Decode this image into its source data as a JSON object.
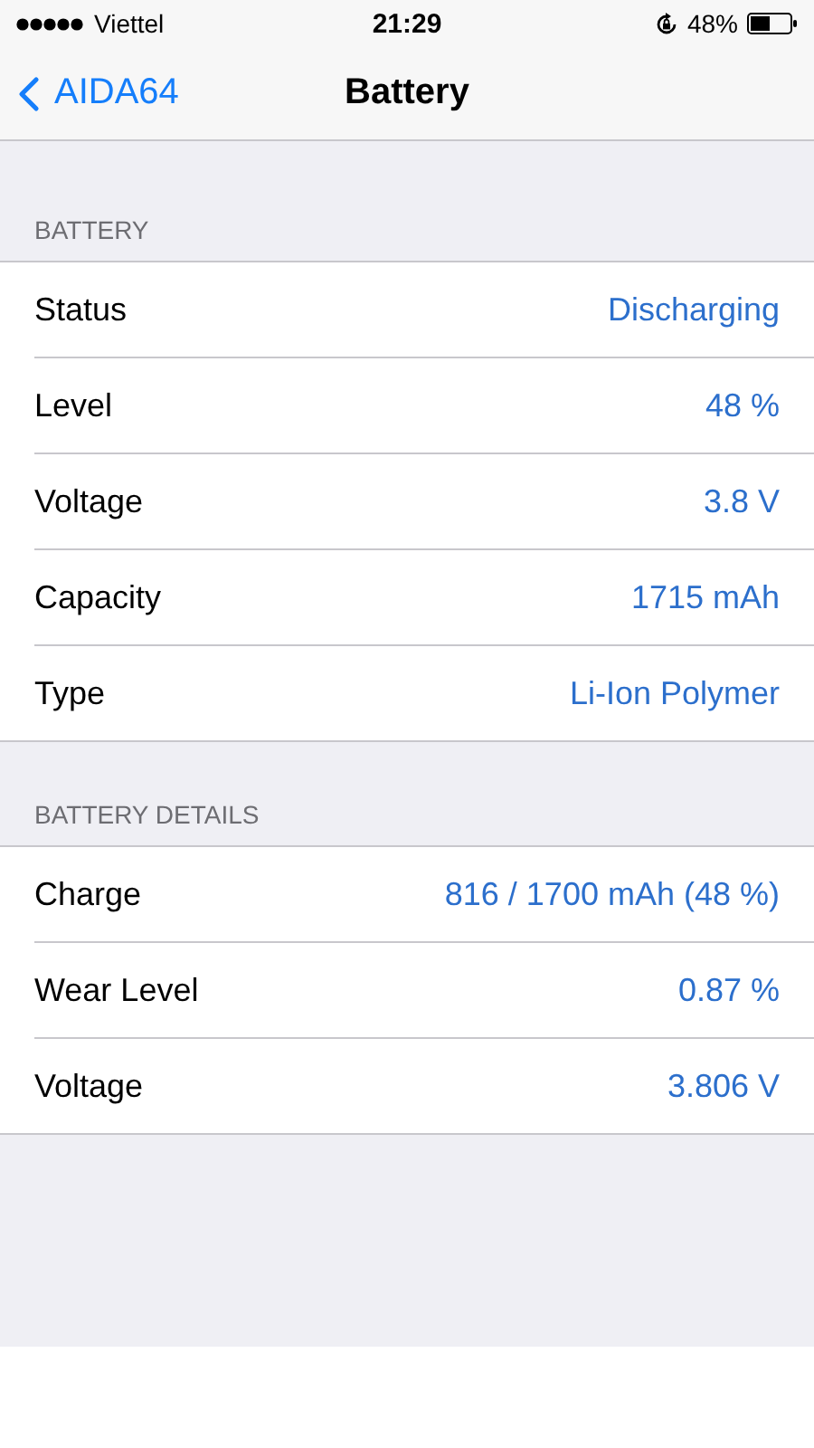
{
  "status_bar": {
    "carrier": "Viettel",
    "time": "21:29",
    "battery": "48%"
  },
  "nav": {
    "back": "AIDA64",
    "title": "Battery"
  },
  "sections": [
    {
      "header": "BATTERY",
      "rows": [
        {
          "label": "Status",
          "value": "Discharging"
        },
        {
          "label": "Level",
          "value": "48 %"
        },
        {
          "label": "Voltage",
          "value": "3.8 V"
        },
        {
          "label": "Capacity",
          "value": "1715 mAh"
        },
        {
          "label": "Type",
          "value": "Li-Ion Polymer"
        }
      ]
    },
    {
      "header": "BATTERY DETAILS",
      "rows": [
        {
          "label": "Charge",
          "value": "816 / 1700 mAh (48 %)"
        },
        {
          "label": "Wear Level",
          "value": "0.87 %"
        },
        {
          "label": "Voltage",
          "value": "3.806 V"
        }
      ]
    }
  ]
}
